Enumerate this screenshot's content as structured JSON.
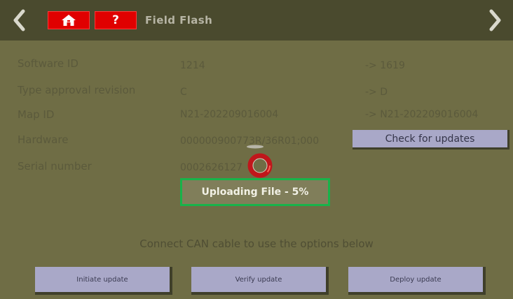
{
  "header": {
    "title": "Field Flash",
    "back_icon": "chevron-left-icon",
    "forward_icon": "chevron-right-icon",
    "home_icon": "home-icon",
    "help_label": "?"
  },
  "info_rows": [
    {
      "label": "Software ID",
      "current": "1214",
      "new": "-> 1619"
    },
    {
      "label": "Type approval revision",
      "current": "C",
      "new": "-> D"
    },
    {
      "label": "Map ID",
      "current": "N21-202209016004",
      "new": "-> N21-202209016004"
    },
    {
      "label": "Hardware",
      "current": "000000900773R/36R01;000",
      "new": ""
    },
    {
      "label": "Serial number",
      "current": "0002626127",
      "new": ""
    }
  ],
  "check_updates_label": "Check for updates",
  "upload_status": "Uploading File - 5%",
  "upload_progress_percent": 5,
  "connect_message": "Connect CAN cable to use the options below",
  "actions": {
    "initiate": "Initiate update",
    "verify": "Verify update",
    "deploy": "Deploy update"
  },
  "colors": {
    "background": "#6f6d45",
    "header": "#4a4a2e",
    "accent_red": "#e00000",
    "highlight_green": "#18b34a",
    "button": "#a9a8c8"
  }
}
